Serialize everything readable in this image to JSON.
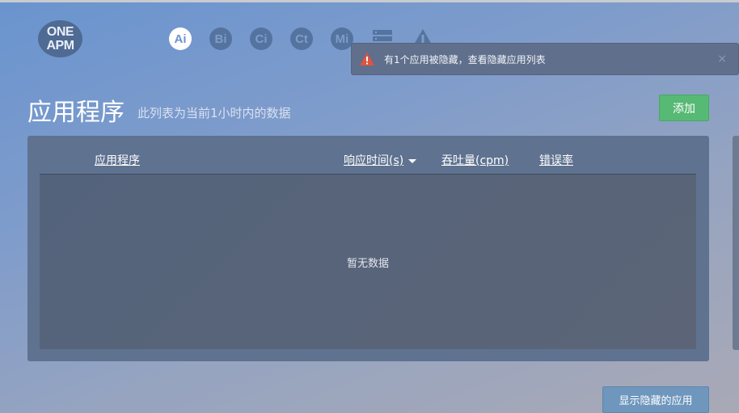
{
  "logo": {
    "line1": "ONE",
    "line2": "APM"
  },
  "nav": [
    {
      "label": "Ai",
      "active": true
    },
    {
      "label": "Bi",
      "active": false
    },
    {
      "label": "Ci",
      "active": false
    },
    {
      "label": "Ct",
      "active": false
    },
    {
      "label": "Mi",
      "active": false
    }
  ],
  "nav_icons": [
    "server-icon",
    "alert-icon"
  ],
  "notice": {
    "message": "有1个应用被隐藏，查看隐藏应用列表",
    "close": "×"
  },
  "page": {
    "title": "应用程序",
    "subtitle": "此列表为当前1小时内的数据"
  },
  "actions": {
    "add": "添加",
    "show_hidden": "显示隐藏的应用"
  },
  "table": {
    "columns": [
      "应用程序",
      "响应时间(s)",
      "吞吐量(cpm)",
      "错误率"
    ],
    "empty_text": "暂无数据"
  },
  "colors": {
    "accent_green": "#56b974",
    "active_nav": "#ffffff",
    "warning": "#e0533f"
  }
}
